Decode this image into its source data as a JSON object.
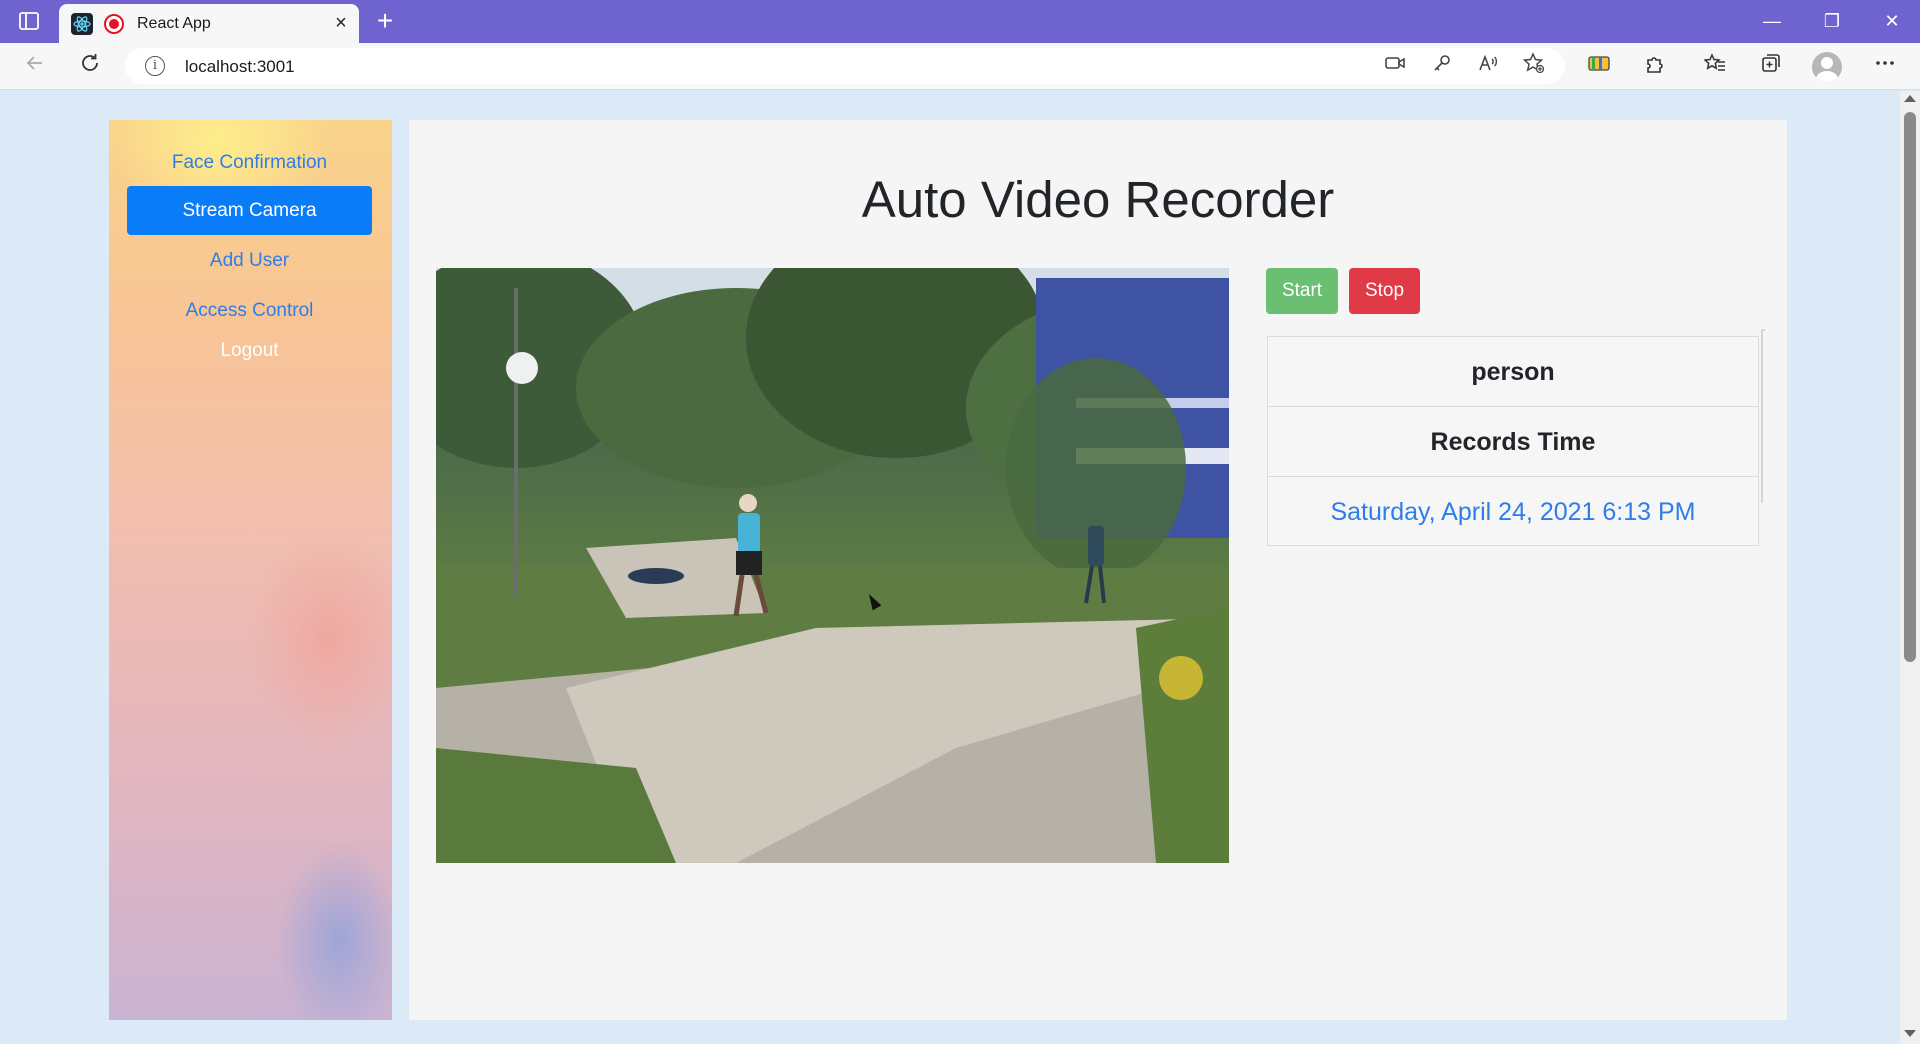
{
  "browser": {
    "tab_title": "React App",
    "tab_close": "×",
    "new_tab": "+",
    "url": "localhost:3001",
    "window_controls": {
      "minimize": "—",
      "restore": "❐",
      "close": "✕"
    },
    "icons": [
      "tab-actions-icon",
      "react-favicon-icon",
      "recording-icon",
      "back-icon",
      "refresh-icon",
      "site-info-icon",
      "camera-icon",
      "key-icon",
      "read-aloud-icon",
      "add-favorite-icon",
      "wallet-icon",
      "extensions-icon",
      "favorites-icon",
      "collections-icon",
      "profile-icon",
      "more-icon"
    ]
  },
  "sidebar": {
    "items": [
      {
        "label": "Face Confirmation",
        "active": false
      },
      {
        "label": "Stream Camera",
        "active": true
      },
      {
        "label": "Add User",
        "active": false
      },
      {
        "label": "Access Control",
        "active": false
      },
      {
        "label": "Logout",
        "active": false
      }
    ]
  },
  "main": {
    "title": "Auto Video Recorder",
    "buttons": {
      "start": "Start",
      "stop": "Stop"
    },
    "records": {
      "header": "person",
      "subheader": "Records Time",
      "time": "Saturday, April 24, 2021 6:13 PM"
    }
  },
  "colors": {
    "tabbar": "#6f63cf",
    "primary": "#0a7cf7",
    "link": "#2f7de8",
    "start": "#6bbf72",
    "stop": "#e13a47"
  }
}
